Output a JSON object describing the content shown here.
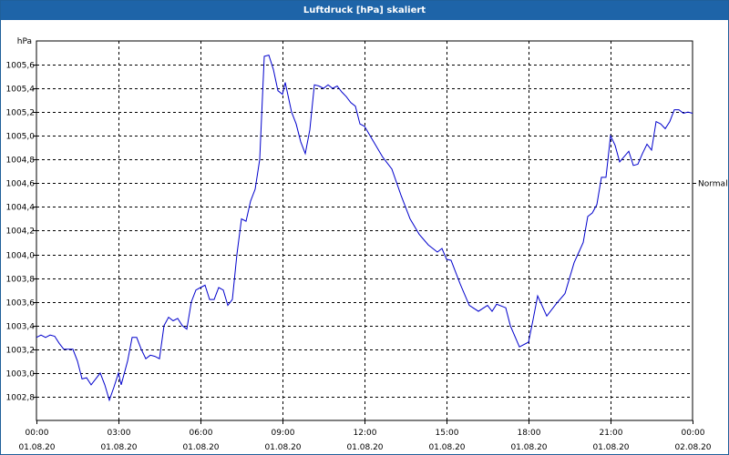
{
  "window": {
    "title": "Luftdruck [hPa] skaliert"
  },
  "chart_data": {
    "type": "line",
    "title": "Luftdruck [hPa] skaliert",
    "ylabel": "hPa",
    "xlabel": "",
    "ylim": [
      1002.6,
      1005.8
    ],
    "xlim": [
      "01.08.20 00:00",
      "02.08.20 00:00"
    ],
    "yticks": [
      1002.8,
      1003.0,
      1003.2,
      1003.4,
      1003.6,
      1003.8,
      1004.0,
      1004.2,
      1004.4,
      1004.6,
      1004.8,
      1005.0,
      1005.2,
      1005.4,
      1005.6
    ],
    "ytick_labels": [
      "1002,8",
      "1003,0",
      "1003,2",
      "1003,4",
      "1003,6",
      "1003,8",
      "1004,0",
      "1004,2",
      "1004,4",
      "1004,6",
      "1004,8",
      "1005,0",
      "1005,2",
      "1005,4",
      "1005,6"
    ],
    "xticks": [
      {
        "time": "00:00",
        "date": "01.08.20"
      },
      {
        "time": "03:00",
        "date": "01.08.20"
      },
      {
        "time": "06:00",
        "date": "01.08.20"
      },
      {
        "time": "09:00",
        "date": "01.08.20"
      },
      {
        "time": "12:00",
        "date": "01.08.20"
      },
      {
        "time": "15:00",
        "date": "01.08.20"
      },
      {
        "time": "18:00",
        "date": "01.08.20"
      },
      {
        "time": "21:00",
        "date": "01.08.20"
      },
      {
        "time": "00:00",
        "date": "02.08.20"
      }
    ],
    "reference_line": {
      "label": "Normal",
      "value": 1004.6
    },
    "grid": true,
    "series": [
      {
        "color": "#0000cc",
        "points": [
          [
            "01.08.20 00:00",
            1003.3
          ],
          [
            "01.08.20 00:10",
            1003.32
          ],
          [
            "01.08.20 00:20",
            1003.3
          ],
          [
            "01.08.20 00:30",
            1003.32
          ],
          [
            "01.08.20 00:40",
            1003.31
          ],
          [
            "01.08.20 00:50",
            1003.25
          ],
          [
            "01.08.20 01:00",
            1003.2
          ],
          [
            "01.08.20 01:10",
            1003.2
          ],
          [
            "01.08.20 01:20",
            1003.2
          ],
          [
            "01.08.20 01:30",
            1003.1
          ],
          [
            "01.08.20 01:40",
            1002.95
          ],
          [
            "01.08.20 01:50",
            1002.96
          ],
          [
            "01.08.20 02:00",
            1002.9
          ],
          [
            "01.08.20 02:10",
            1002.95
          ],
          [
            "01.08.20 02:20",
            1003.0
          ],
          [
            "01.08.20 02:30",
            1002.9
          ],
          [
            "01.08.20 02:40",
            1002.77
          ],
          [
            "01.08.20 02:50",
            1002.88
          ],
          [
            "01.08.20 03:00",
            1003.0
          ],
          [
            "01.08.20 03:06",
            1002.9
          ],
          [
            "01.08.20 03:20",
            1003.1
          ],
          [
            "01.08.20 03:30",
            1003.3
          ],
          [
            "01.08.20 03:40",
            1003.3
          ],
          [
            "01.08.20 03:50",
            1003.2
          ],
          [
            "01.08.20 04:00",
            1003.12
          ],
          [
            "01.08.20 04:10",
            1003.15
          ],
          [
            "01.08.20 04:20",
            1003.14
          ],
          [
            "01.08.20 04:30",
            1003.12
          ],
          [
            "01.08.20 04:40",
            1003.4
          ],
          [
            "01.08.20 04:50",
            1003.47
          ],
          [
            "01.08.20 05:00",
            1003.44
          ],
          [
            "01.08.20 05:10",
            1003.46
          ],
          [
            "01.08.20 05:20",
            1003.4
          ],
          [
            "01.08.20 05:30",
            1003.37
          ],
          [
            "01.08.20 05:40",
            1003.6
          ],
          [
            "01.08.20 05:50",
            1003.7
          ],
          [
            "01.08.20 06:00",
            1003.72
          ],
          [
            "01.08.20 06:10",
            1003.74
          ],
          [
            "01.08.20 06:20",
            1003.62
          ],
          [
            "01.08.20 06:30",
            1003.62
          ],
          [
            "01.08.20 06:40",
            1003.72
          ],
          [
            "01.08.20 06:50",
            1003.7
          ],
          [
            "01.08.20 07:00",
            1003.57
          ],
          [
            "01.08.20 07:10",
            1003.62
          ],
          [
            "01.08.20 07:20",
            1004.0
          ],
          [
            "01.08.20 07:30",
            1004.3
          ],
          [
            "01.08.20 07:40",
            1004.28
          ],
          [
            "01.08.20 07:50",
            1004.45
          ],
          [
            "01.08.20 08:00",
            1004.55
          ],
          [
            "01.08.20 08:10",
            1004.8
          ],
          [
            "01.08.20 08:20",
            1005.67
          ],
          [
            "01.08.20 08:30",
            1005.68
          ],
          [
            "01.08.20 08:40",
            1005.56
          ],
          [
            "01.08.20 08:50",
            1005.38
          ],
          [
            "01.08.20 09:00",
            1005.35
          ],
          [
            "01.08.20 09:06",
            1005.45
          ],
          [
            "01.08.20 09:20",
            1005.2
          ],
          [
            "01.08.20 09:30",
            1005.1
          ],
          [
            "01.08.20 09:40",
            1004.95
          ],
          [
            "01.08.20 09:50",
            1004.85
          ],
          [
            "01.08.20 10:00",
            1005.05
          ],
          [
            "01.08.20 10:10",
            1005.43
          ],
          [
            "01.08.20 10:20",
            1005.42
          ],
          [
            "01.08.20 10:30",
            1005.4
          ],
          [
            "01.08.20 10:40",
            1005.43
          ],
          [
            "01.08.20 10:50",
            1005.4
          ],
          [
            "01.08.20 11:00",
            1005.42
          ],
          [
            "01.08.20 11:10",
            1005.37
          ],
          [
            "01.08.20 11:20",
            1005.33
          ],
          [
            "01.08.20 11:30",
            1005.28
          ],
          [
            "01.08.20 11:40",
            1005.25
          ],
          [
            "01.08.20 11:50",
            1005.1
          ],
          [
            "01.08.20 12:00",
            1005.08
          ],
          [
            "01.08.20 12:20",
            1004.95
          ],
          [
            "01.08.20 12:40",
            1004.82
          ],
          [
            "01.08.20 13:00",
            1004.72
          ],
          [
            "01.08.20 13:20",
            1004.5
          ],
          [
            "01.08.20 13:40",
            1004.3
          ],
          [
            "01.08.20 14:00",
            1004.17
          ],
          [
            "01.08.20 14:20",
            1004.08
          ],
          [
            "01.08.20 14:40",
            1004.02
          ],
          [
            "01.08.20 14:50",
            1004.05
          ],
          [
            "01.08.20 15:00",
            1003.96
          ],
          [
            "01.08.20 15:10",
            1003.95
          ],
          [
            "01.08.20 15:30",
            1003.75
          ],
          [
            "01.08.20 15:50",
            1003.57
          ],
          [
            "01.08.20 16:10",
            1003.52
          ],
          [
            "01.08.20 16:30",
            1003.57
          ],
          [
            "01.08.20 16:40",
            1003.52
          ],
          [
            "01.08.20 16:50",
            1003.58
          ],
          [
            "01.08.20 17:10",
            1003.55
          ],
          [
            "01.08.20 17:20",
            1003.4
          ],
          [
            "01.08.20 17:40",
            1003.22
          ],
          [
            "01.08.20 18:00",
            1003.26
          ],
          [
            "01.08.20 18:10",
            1003.45
          ],
          [
            "01.08.20 18:20",
            1003.65
          ],
          [
            "01.08.20 18:40",
            1003.48
          ],
          [
            "01.08.20 19:00",
            1003.58
          ],
          [
            "01.08.20 19:20",
            1003.67
          ],
          [
            "01.08.20 19:40",
            1003.93
          ],
          [
            "01.08.20 20:00",
            1004.1
          ],
          [
            "01.08.20 20:10",
            1004.32
          ],
          [
            "01.08.20 20:20",
            1004.35
          ],
          [
            "01.08.20 20:30",
            1004.42
          ],
          [
            "01.08.20 20:40",
            1004.65
          ],
          [
            "01.08.20 20:50",
            1004.65
          ],
          [
            "01.08.20 21:00",
            1005.0
          ],
          [
            "01.08.20 21:10",
            1004.92
          ],
          [
            "01.08.20 21:20",
            1004.78
          ],
          [
            "01.08.20 21:40",
            1004.87
          ],
          [
            "01.08.20 21:50",
            1004.75
          ],
          [
            "01.08.20 22:00",
            1004.76
          ],
          [
            "01.08.20 22:10",
            1004.85
          ],
          [
            "01.08.20 22:20",
            1004.93
          ],
          [
            "01.08.20 22:30",
            1004.88
          ],
          [
            "01.08.20 22:40",
            1005.12
          ],
          [
            "01.08.20 22:50",
            1005.1
          ],
          [
            "01.08.20 23:00",
            1005.06
          ],
          [
            "01.08.20 23:10",
            1005.12
          ],
          [
            "01.08.20 23:20",
            1005.22
          ],
          [
            "01.08.20 23:30",
            1005.22
          ],
          [
            "01.08.20 23:40",
            1005.19
          ],
          [
            "01.08.20 23:50",
            1005.2
          ],
          [
            "02.08.20 00:00",
            1005.19
          ]
        ]
      }
    ]
  }
}
